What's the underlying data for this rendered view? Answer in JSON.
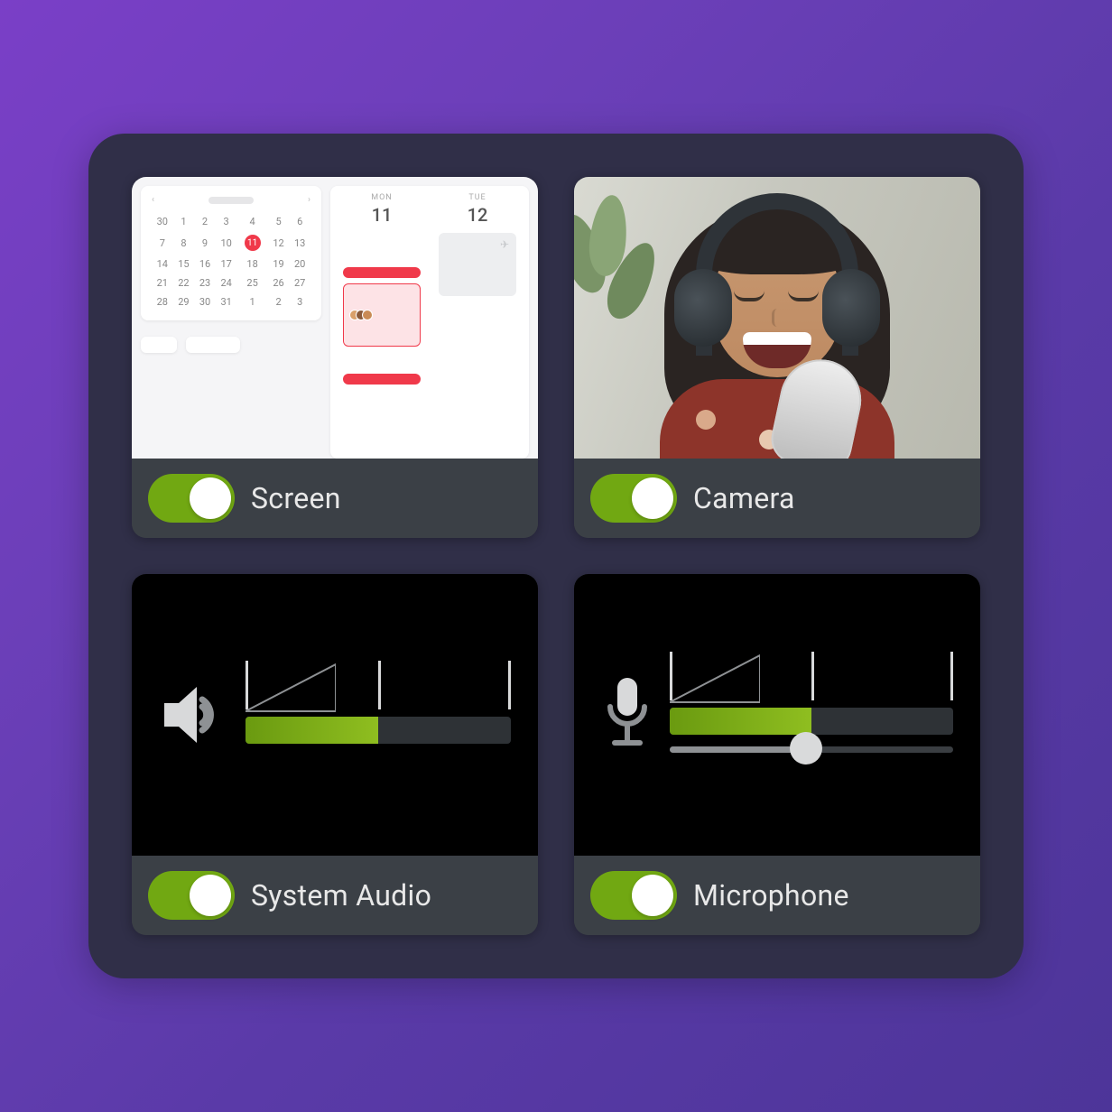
{
  "colors": {
    "accent": "#71a812",
    "panel": "#302f48",
    "card": "#3b4046"
  },
  "cards": {
    "screen": {
      "label": "Screen",
      "toggle_on": true
    },
    "camera": {
      "label": "Camera",
      "toggle_on": true
    },
    "system_audio": {
      "label": "System Audio",
      "toggle_on": true,
      "level_percent": 50
    },
    "microphone": {
      "label": "Microphone",
      "toggle_on": true,
      "level_percent": 50,
      "gain_percent": 48
    }
  },
  "screen_calendar": {
    "day_headers": [
      "MON",
      "TUE"
    ],
    "day_numbers": [
      "11",
      "12"
    ],
    "selected_date": "11",
    "mini_days": [
      [
        "30",
        "1",
        "2",
        "3",
        "4",
        "5",
        "6"
      ],
      [
        "7",
        "8",
        "9",
        "10",
        "11",
        "12",
        "13"
      ],
      [
        "14",
        "15",
        "16",
        "17",
        "18",
        "19",
        "20"
      ],
      [
        "21",
        "22",
        "23",
        "24",
        "25",
        "26",
        "27"
      ],
      [
        "28",
        "29",
        "30",
        "31",
        "1",
        "2",
        "3"
      ]
    ]
  }
}
